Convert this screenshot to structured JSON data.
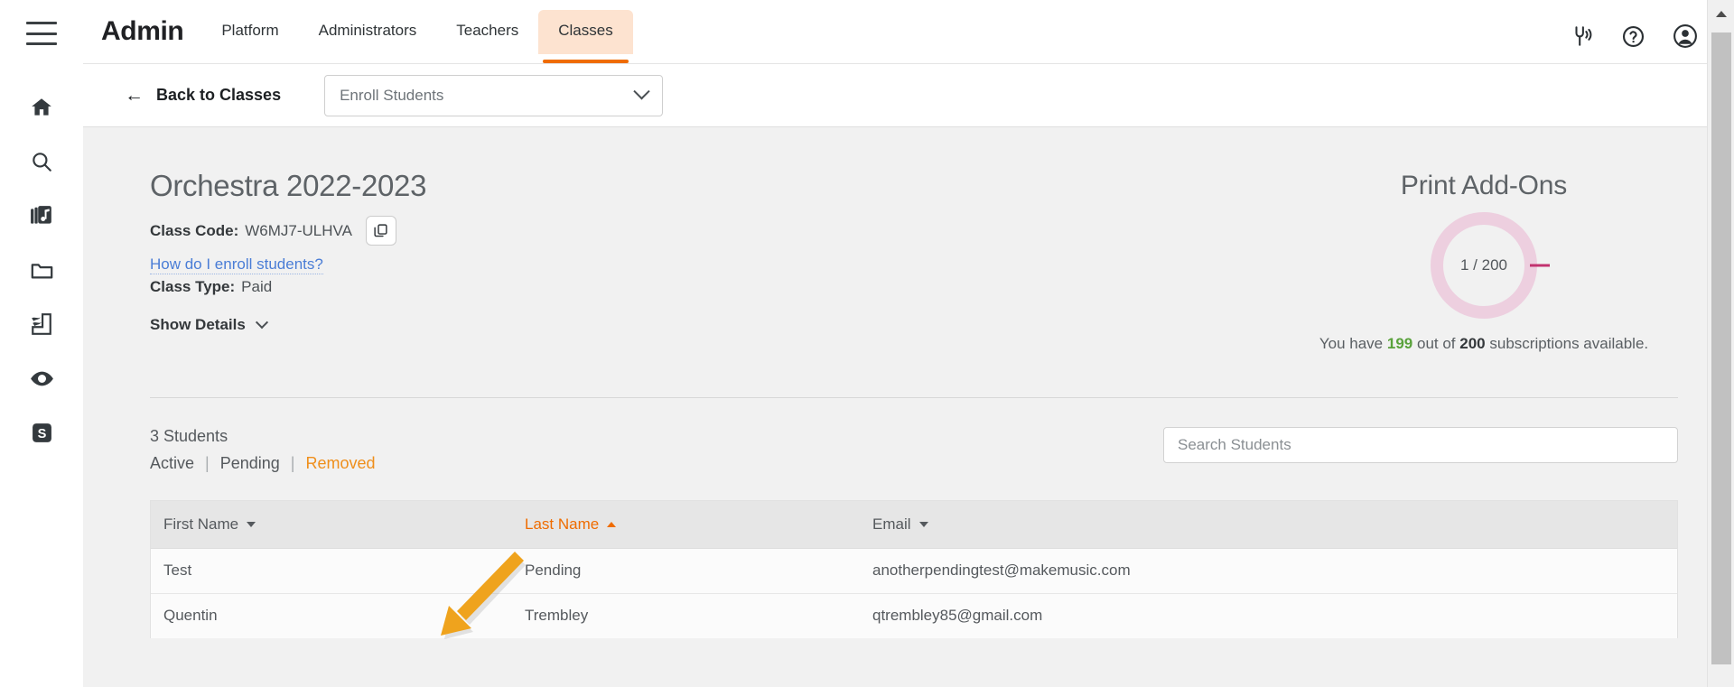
{
  "colors": {
    "accent": "#ef6c00",
    "tab_bg": "#fde3d0",
    "link": "#4a7dd6",
    "annotation_arrow": "#efa31d",
    "donut_ring": "#edcfdf",
    "donut_used": "#c2326f",
    "available_green": "#5aa23c"
  },
  "topnav": {
    "menu_icon": "hamburger-menu-icon",
    "brand": "Admin",
    "tabs": [
      {
        "label": "Platform",
        "active": false
      },
      {
        "label": "Administrators",
        "active": false
      },
      {
        "label": "Teachers",
        "active": false
      },
      {
        "label": "Classes",
        "active": true
      }
    ],
    "right_icons": [
      {
        "name": "tuning-fork-icon"
      },
      {
        "name": "help-circle-icon"
      },
      {
        "name": "account-avatar-icon"
      }
    ]
  },
  "sidebar": {
    "items": [
      {
        "name": "home-icon",
        "label": "Home"
      },
      {
        "name": "search-icon",
        "label": "Search"
      },
      {
        "name": "music-library-icon",
        "label": "Library"
      },
      {
        "name": "folder-icon",
        "label": "Folder"
      },
      {
        "name": "compose-icon",
        "label": "Compose"
      },
      {
        "name": "eye-icon",
        "label": "Preview"
      },
      {
        "name": "s-badge-icon",
        "label": "S"
      }
    ]
  },
  "subbar": {
    "back_label": "Back to Classes",
    "back_arrow": "←",
    "enroll_select_value": "Enroll Students"
  },
  "class": {
    "title": "Orchestra 2022-2023",
    "code_label": "Class Code:",
    "code_value": "W6MJ7-ULHVA",
    "copy_icon": "copy-icon",
    "enroll_help_link": "How do I enroll students?",
    "type_label": "Class Type:",
    "type_value": "Paid",
    "show_details_label": "Show Details"
  },
  "addons": {
    "title": "Print Add-Ons",
    "donut_value": "1 / 200",
    "note_prefix": "You have",
    "note_available": "199",
    "note_middle": "out of",
    "note_total": "200",
    "note_suffix": "subscriptions available."
  },
  "students": {
    "count_label": "3 Students",
    "filters": [
      {
        "label": "Active",
        "active": false
      },
      {
        "label": "Pending",
        "active": false
      },
      {
        "label": "Removed",
        "active": true
      }
    ],
    "separator": "|",
    "search_placeholder": "Search Students",
    "columns": [
      {
        "label": "First Name",
        "sort": "desc",
        "active": false
      },
      {
        "label": "Last Name",
        "sort": "asc",
        "active": true
      },
      {
        "label": "Email",
        "sort": "desc",
        "active": false
      }
    ],
    "rows": [
      {
        "first_name": "Test",
        "last_name": "Pending",
        "email": "anotherpendingtest@makemusic.com"
      },
      {
        "first_name": "Quentin",
        "last_name": "Trembley",
        "email": "qtrembley85@gmail.com"
      }
    ]
  },
  "annotation": {
    "name": "orange-pointer-arrow",
    "points_to": "Removed"
  }
}
